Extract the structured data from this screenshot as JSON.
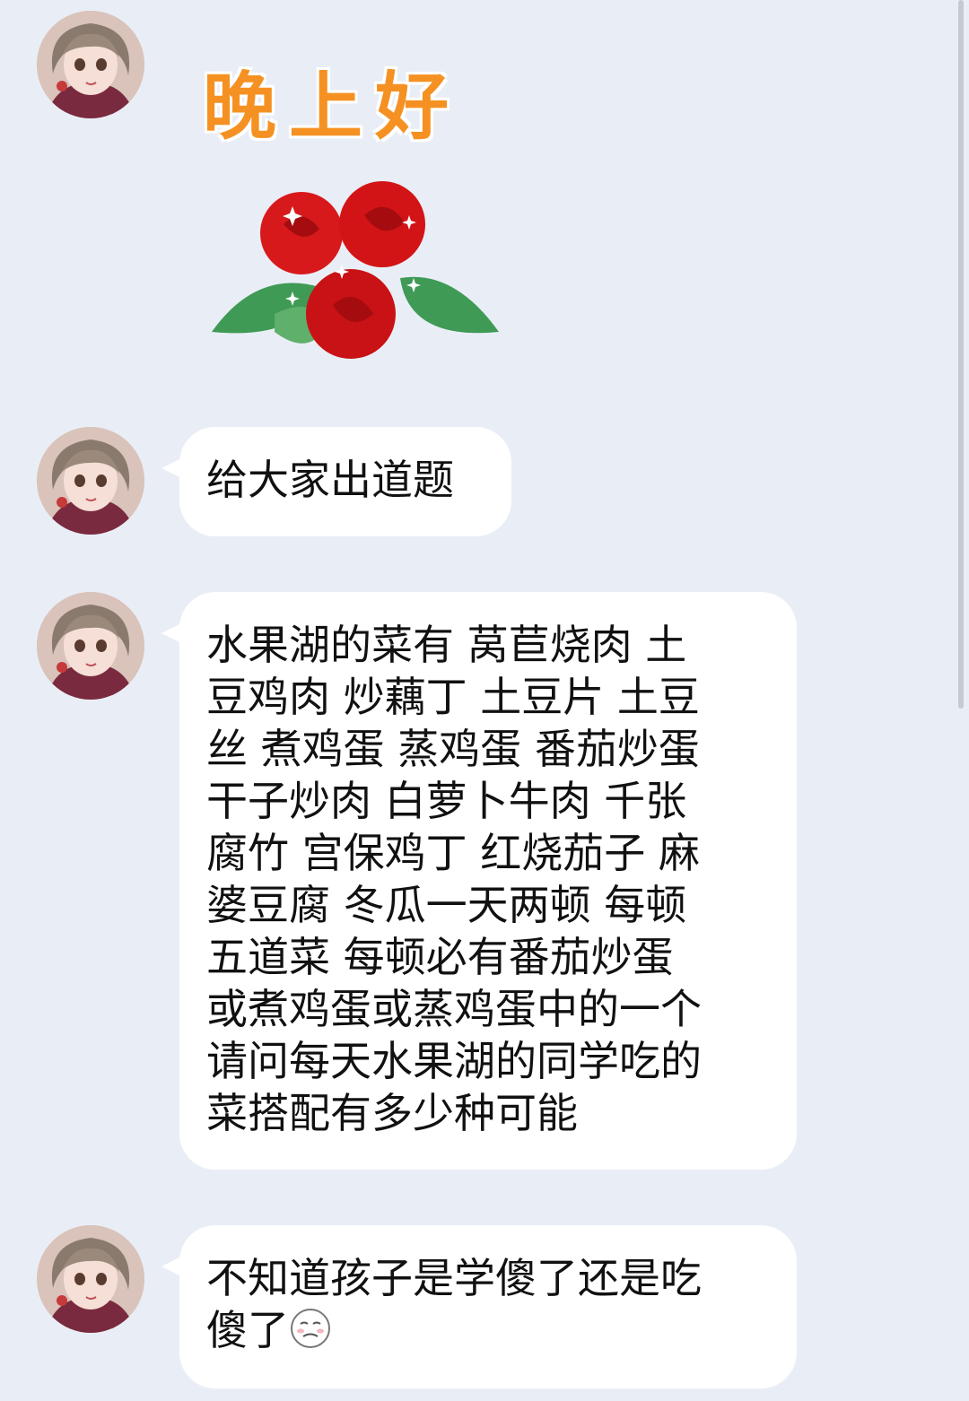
{
  "messages": [
    {
      "type": "sticker",
      "text": "晚上好"
    },
    {
      "type": "text",
      "text": "给大家出道题"
    },
    {
      "type": "text",
      "text": "水果湖的菜有 莴苣烧肉 土\n豆鸡肉 炒藕丁 土豆片 土豆\n丝 煮鸡蛋 蒸鸡蛋 番茄炒蛋\n干子炒肉 白萝卜牛肉 千张\n腐竹 宫保鸡丁 红烧茄子 麻\n婆豆腐 冬瓜一天两顿 每顿\n五道菜 每顿必有番茄炒蛋\n或煮鸡蛋或蒸鸡蛋中的一个\n请问每天水果湖的同学吃的\n菜搭配有多少种可能"
    },
    {
      "type": "text",
      "text": "不知道孩子是学傻了还是吃\n傻了",
      "emoji": "smirk-emoji"
    }
  ],
  "colors": {
    "background": "#e9eef6",
    "bubble": "#ffffff",
    "greeting": "#f59122",
    "rose": "#d8191c",
    "leaf": "#3f9a55"
  }
}
